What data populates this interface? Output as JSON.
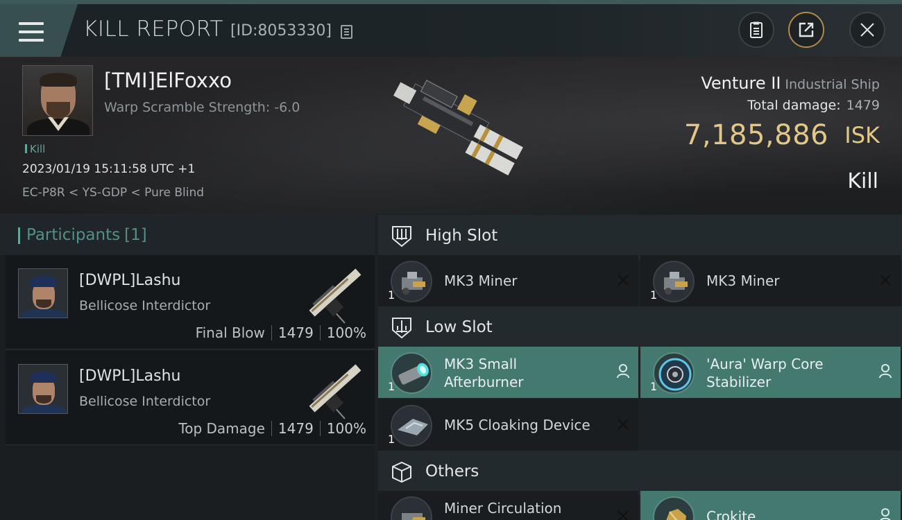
{
  "header": {
    "title": "KILL REPORT",
    "report_id": "[ID:8053330]",
    "buttons": {
      "menu": "menu-icon",
      "clipboard": "clipboard-icon",
      "share": "share-icon",
      "close": "close-icon"
    }
  },
  "victim": {
    "name": "[TMI]ElFoxxo",
    "stat": "Warp Scramble Strength: -6.0",
    "tag": "Kill",
    "time": "2023/01/19 15:11:58 UTC +1",
    "location": "EC-P8R < YS-GDP < Pure Blind",
    "ship_name": "Venture II",
    "ship_class": "Industrial Ship",
    "total_damage_label": "Total damage:",
    "total_damage_value": "1479",
    "isk_value": "7,185,886",
    "isk_unit": "ISK",
    "result": "Kill"
  },
  "participants": {
    "title": "Participants",
    "count": "[1]",
    "rows": [
      {
        "name": "[DWPL]Lashu",
        "ship": "Bellicose Interdictor",
        "role": "Final Blow",
        "damage": "1479",
        "percent": "100%"
      },
      {
        "name": "[DWPL]Lashu",
        "ship": "Bellicose Interdictor",
        "role": "Top Damage",
        "damage": "1479",
        "percent": "100%"
      }
    ]
  },
  "fitting": {
    "high_slot": {
      "label": "High Slot",
      "items": [
        {
          "qty": "1",
          "name": "MK3 Miner",
          "status": "destroyed"
        },
        {
          "qty": "1",
          "name": "MK3 Miner",
          "status": "destroyed"
        }
      ]
    },
    "low_slot": {
      "label": "Low Slot",
      "items": [
        {
          "qty": "1",
          "name_line1": "MK3 Small",
          "name_line2": "Afterburner",
          "status": "dropped"
        },
        {
          "qty": "1",
          "name_line1": "'Aura' Warp Core",
          "name_line2": "Stabilizer",
          "status": "dropped"
        },
        {
          "qty": "1",
          "name": "MK5 Cloaking Device",
          "status": "destroyed"
        }
      ]
    },
    "others": {
      "label": "Others",
      "items": [
        {
          "name": "Miner Circulation",
          "status": "destroyed"
        },
        {
          "name": "Crokite",
          "status": "dropped"
        }
      ]
    }
  },
  "colors": {
    "accent_teal": "#5fa89c",
    "fitted_bg": "#44796f",
    "isk_gold": "#e3c787"
  }
}
